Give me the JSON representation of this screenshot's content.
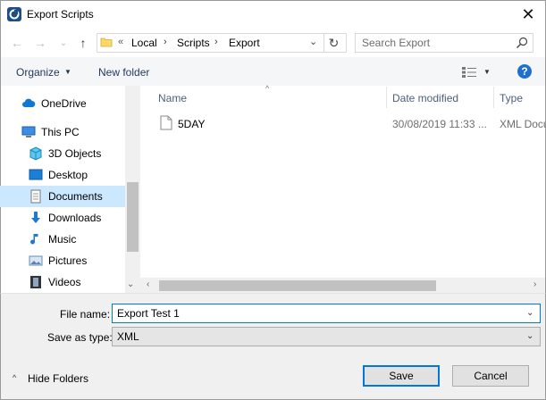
{
  "window": {
    "title": "Export Scripts",
    "close_glyph": "✕",
    "app_icon": "app-logo-icon"
  },
  "nav_buttons": {
    "back": "←",
    "forward": "→",
    "recent": "⌄",
    "up": "↑"
  },
  "address": {
    "prefix": "«",
    "crumbs": [
      "Local",
      "Scripts",
      "Export"
    ],
    "separator": "›",
    "dropdown": "⌄",
    "refresh": "↻"
  },
  "search": {
    "placeholder": "Search Export"
  },
  "toolbar": {
    "organize_label": "Organize",
    "caret": "▼",
    "new_folder_label": "New folder",
    "help_label": "?"
  },
  "nav_pane": {
    "items": [
      {
        "label": "OneDrive",
        "icon": "cloud-icon"
      },
      {
        "label": "This PC",
        "icon": "computer-icon"
      },
      {
        "label": "3D Objects",
        "icon": "cube-icon"
      },
      {
        "label": "Desktop",
        "icon": "desktop-icon"
      },
      {
        "label": "Documents",
        "icon": "document-icon",
        "selected": true
      },
      {
        "label": "Downloads",
        "icon": "download-arrow-icon"
      },
      {
        "label": "Music",
        "icon": "music-note-icon"
      },
      {
        "label": "Pictures",
        "icon": "picture-icon"
      },
      {
        "label": "Videos",
        "icon": "film-icon"
      }
    ],
    "scroll_down": "⌄"
  },
  "file_list": {
    "columns": [
      "Name",
      "Date modified",
      "Type"
    ],
    "sort_caret": "^",
    "rows": [
      {
        "name": "5DAY",
        "date_modified": "30/08/2019 11:33 ...",
        "type": "XML Docu"
      }
    ],
    "scroll_left": "‹",
    "scroll_right": "›"
  },
  "form": {
    "file_name_label": "File name:",
    "file_name_value": "Export Test 1",
    "save_as_type_label": "Save as type:",
    "save_as_type_value": "XML",
    "caret": "⌄"
  },
  "footer": {
    "hide_folders_label": "Hide Folders",
    "hide_caret": "^",
    "save_label": "Save",
    "cancel_label": "Cancel"
  },
  "colors": {
    "accent": "#0078d7",
    "selection": "#cce8ff",
    "help": "#1f6fd0"
  }
}
